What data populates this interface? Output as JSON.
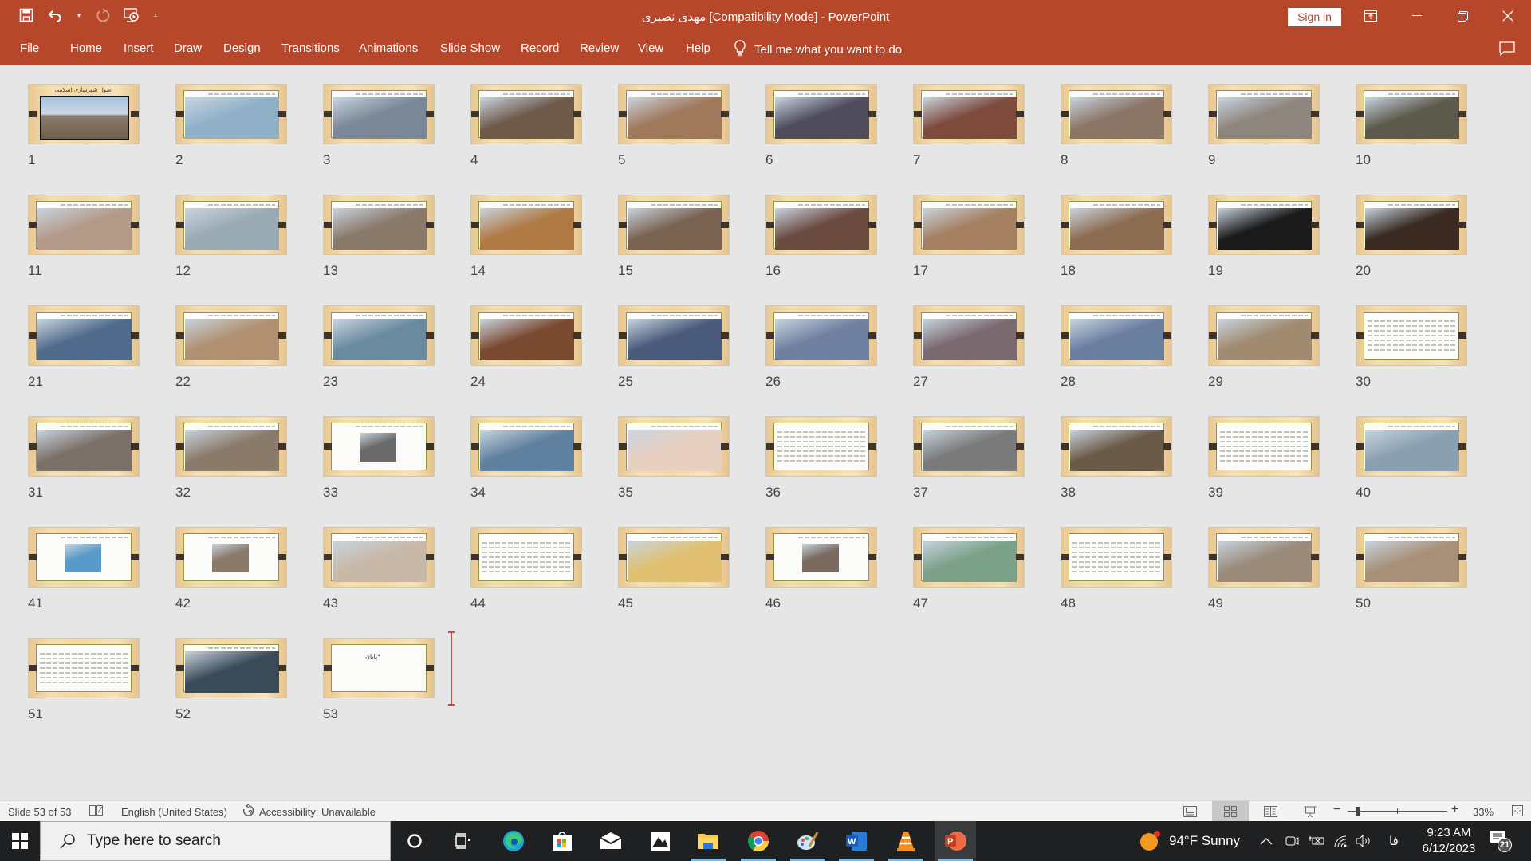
{
  "window": {
    "title": "مهدی نصیری [Compatibility Mode]  -  PowerPoint",
    "sign_in_label": "Sign in"
  },
  "quick_access": [
    "save-icon",
    "undo-icon",
    "redo-icon",
    "start-from-beginning-icon",
    "customize-qat-icon"
  ],
  "ribbon": {
    "tabs": [
      "File",
      "Home",
      "Insert",
      "Draw",
      "Design",
      "Transitions",
      "Animations",
      "Slide Show",
      "Record",
      "Review",
      "View",
      "Help"
    ],
    "tell_me": "Tell me what you want to do"
  },
  "slides": {
    "first_slide_title": "اصول شهرسازی اسلامی",
    "last_slide_text": "پایان*",
    "items": [
      {
        "n": "1",
        "pic": "#8b7b6a"
      },
      {
        "n": "2",
        "pic": "#8fb0c8"
      },
      {
        "n": "3",
        "pic": "#7a8897"
      },
      {
        "n": "4",
        "pic": "#6f5a4a"
      },
      {
        "n": "5",
        "pic": "#a0785a"
      },
      {
        "n": "6",
        "pic": "#4f4d5c"
      },
      {
        "n": "7",
        "pic": "#7d4a3c"
      },
      {
        "n": "8",
        "pic": "#8a7566"
      },
      {
        "n": "9",
        "pic": "#8e857c"
      },
      {
        "n": "10",
        "pic": "#5c5a4a"
      },
      {
        "n": "11",
        "pic": "#b39a88"
      },
      {
        "n": "12",
        "pic": "#9aaab5"
      },
      {
        "n": "13",
        "pic": "#8a7a6a"
      },
      {
        "n": "14",
        "pic": "#b07a45"
      },
      {
        "n": "15",
        "pic": "#7a6250"
      },
      {
        "n": "16",
        "pic": "#6b4a40"
      },
      {
        "n": "17",
        "pic": "#a47f60"
      },
      {
        "n": "18",
        "pic": "#8c6c50"
      },
      {
        "n": "19",
        "pic": "#1a1a1a"
      },
      {
        "n": "20",
        "pic": "#3a2a22"
      },
      {
        "n": "21",
        "pic": "#4f6a8a"
      },
      {
        "n": "22",
        "pic": "#b09070"
      },
      {
        "n": "23",
        "pic": "#6a8aa0"
      },
      {
        "n": "24",
        "pic": "#7a4a30"
      },
      {
        "n": "25",
        "pic": "#4a5a7a"
      },
      {
        "n": "26",
        "pic": "#7080a0"
      },
      {
        "n": "27",
        "pic": "#7a6a70"
      },
      {
        "n": "28",
        "pic": "#6a7ea0"
      },
      {
        "n": "29",
        "pic": "#a08a70"
      },
      {
        "n": "30",
        "pic": "#fbfbfa"
      },
      {
        "n": "31",
        "pic": "#7a7068"
      },
      {
        "n": "32",
        "pic": "#8a7a6a"
      },
      {
        "n": "33",
        "pic": "#6a6a6a"
      },
      {
        "n": "34",
        "pic": "#6080a0"
      },
      {
        "n": "35",
        "pic": "#e8d0c0"
      },
      {
        "n": "36",
        "pic": "#fbfbfa"
      },
      {
        "n": "37",
        "pic": "#7a7a7a"
      },
      {
        "n": "38",
        "pic": "#6a5a48"
      },
      {
        "n": "39",
        "pic": "#fbfbfa"
      },
      {
        "n": "40",
        "pic": "#8aa0b0"
      },
      {
        "n": "41",
        "pic": "#5a9ac8"
      },
      {
        "n": "42",
        "pic": "#8a7a6a"
      },
      {
        "n": "43",
        "pic": "#c8b8a8"
      },
      {
        "n": "44",
        "pic": "#fbfbfa"
      },
      {
        "n": "45",
        "pic": "#e0c070"
      },
      {
        "n": "46",
        "pic": "#7a6a60"
      },
      {
        "n": "47",
        "pic": "#7aa088"
      },
      {
        "n": "48",
        "pic": "#fbfbfa"
      },
      {
        "n": "49",
        "pic": "#9a8a7a"
      },
      {
        "n": "50",
        "pic": "#a89078"
      },
      {
        "n": "51",
        "pic": "#fbfbfa"
      },
      {
        "n": "52",
        "pic": "#3a4a58"
      },
      {
        "n": "53",
        "pic": "#fbfbfa"
      }
    ]
  },
  "status_bar": {
    "slide_indicator": "Slide 53 of 53",
    "language": "English (United States)",
    "accessibility": "Accessibility: Unavailable",
    "zoom_level": "33%",
    "zoom_fraction": 0.33,
    "active_view": "slide-sorter"
  },
  "taskbar": {
    "search_placeholder": "Type here to search",
    "weather": "94°F  Sunny",
    "lang_indicator": "فا",
    "time": "9:23 AM",
    "date": "6/12/2023",
    "notification_count": "21",
    "apps": [
      "cortana",
      "task-view",
      "edge",
      "store",
      "mail",
      "photos",
      "file-explorer",
      "chrome",
      "paint",
      "word",
      "vlc",
      "powerpoint"
    ]
  }
}
